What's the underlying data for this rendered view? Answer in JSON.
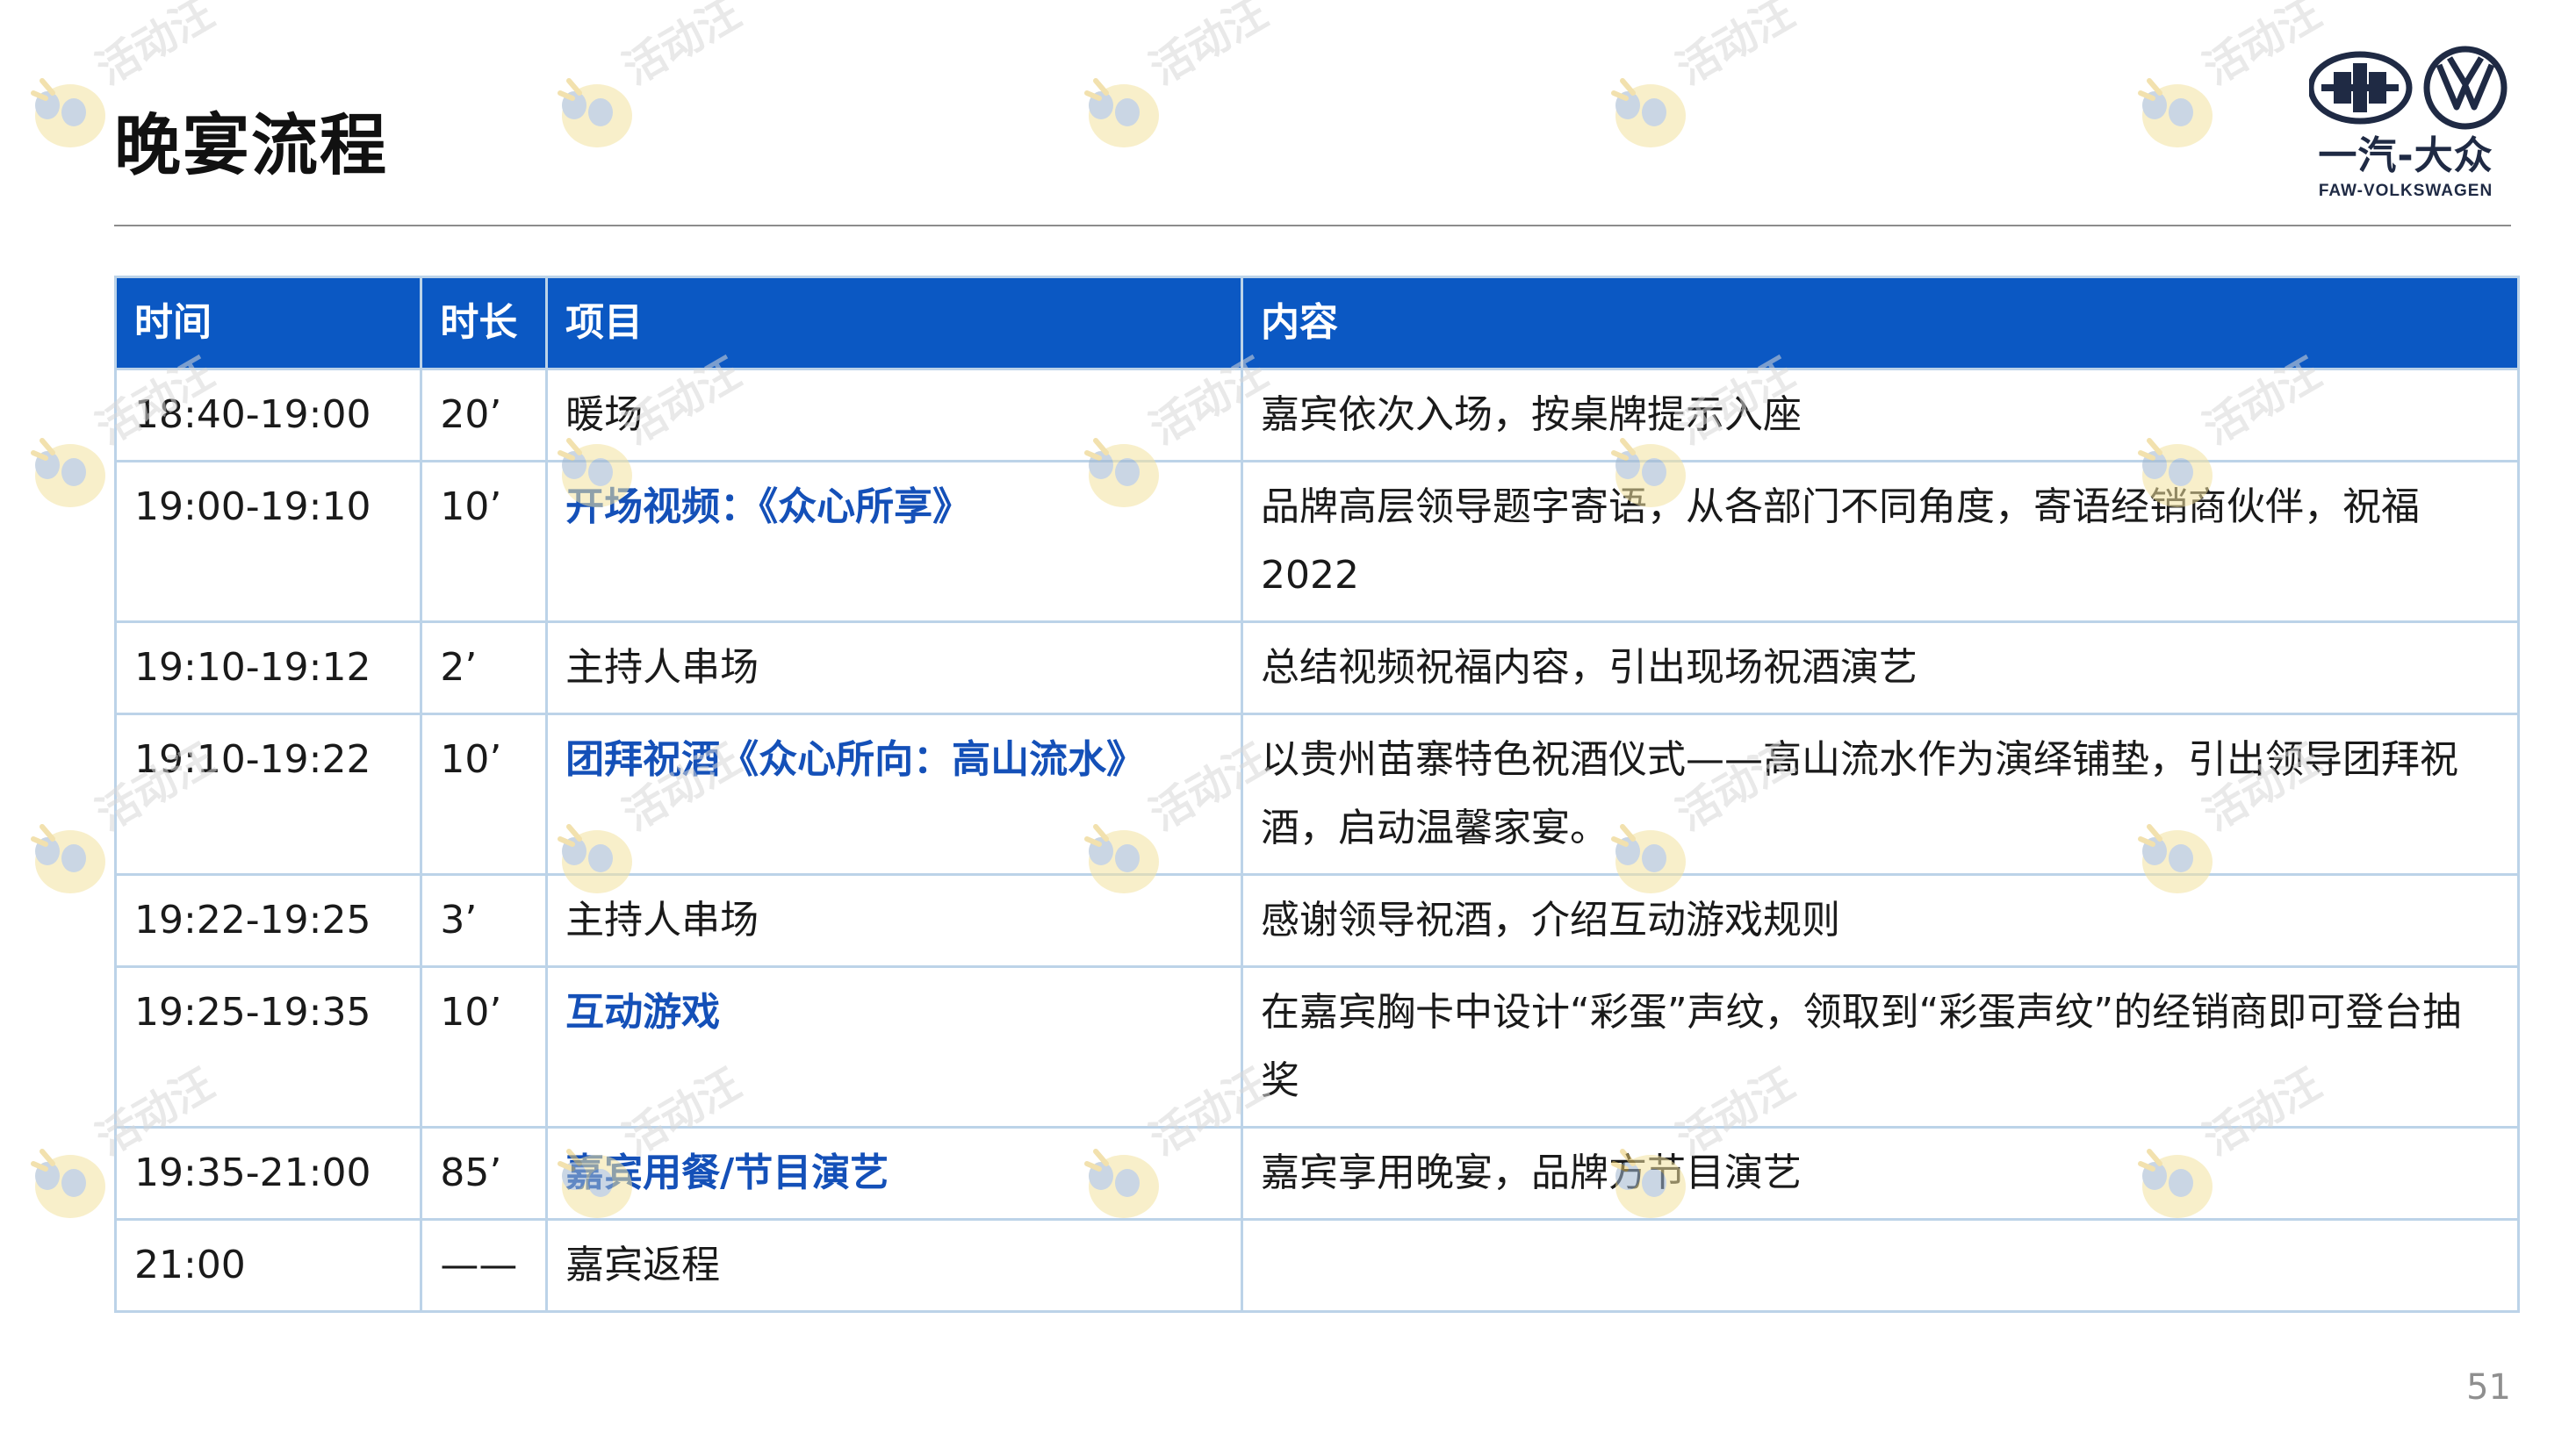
{
  "title": "晚宴流程",
  "logo": {
    "cn_text": "一汽-大众",
    "en_text": "FAW-VOLKSWAGEN",
    "color": "#1f2a44"
  },
  "watermark_text": "活动汪",
  "table": {
    "header_color": "#0b58c3",
    "highlight_color": "#1450b8",
    "headers": [
      "时间",
      "时长",
      "项目",
      "内容"
    ],
    "rows": [
      {
        "time": "18:40-19:00",
        "duration": "20’",
        "item": "暖场",
        "content": "嘉宾依次入场，按桌牌提示入座",
        "highlight": false
      },
      {
        "time": "19:00-19:10",
        "duration": "10’",
        "item": "开场视频：《众心所享》",
        "content": "品牌高层领导题字寄语，从各部门不同角度，寄语经销商伙伴，祝福2022",
        "highlight": true
      },
      {
        "time": "19:10-19:12",
        "duration": "2’",
        "item": "主持人串场",
        "content": "总结视频祝福内容，引出现场祝酒演艺",
        "highlight": false
      },
      {
        "time": "19:10-19:22",
        "duration": "10’",
        "item": "团拜祝酒《众心所向：高山流水》",
        "content": "以贵州苗寨特色祝酒仪式——高山流水作为演绎铺垫，引出领导团拜祝酒，启动温馨家宴。",
        "highlight": true
      },
      {
        "time": "19:22-19:25",
        "duration": "3’",
        "item": "主持人串场",
        "content": "感谢领导祝酒，介绍互动游戏规则",
        "highlight": false
      },
      {
        "time": "19:25-19:35",
        "duration": "10’",
        "item": "互动游戏",
        "content": "在嘉宾胸卡中设计“彩蛋”声纹，领取到“彩蛋声纹”的经销商即可登台抽奖",
        "highlight": true
      },
      {
        "time": "19:35-21:00",
        "duration": "85’",
        "item": "嘉宾用餐/节目演艺",
        "content": "嘉宾享用晚宴，品牌方节目演艺",
        "highlight": true
      },
      {
        "time": "21:00",
        "duration": "——",
        "item": "嘉宾返程",
        "content": "",
        "highlight": false
      }
    ]
  },
  "page_number": "51"
}
